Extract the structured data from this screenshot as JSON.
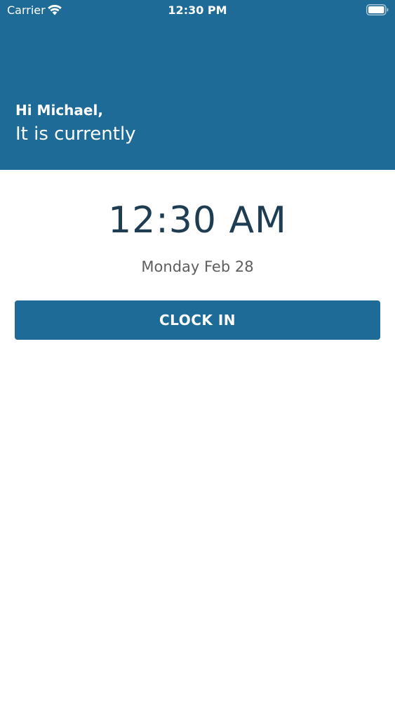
{
  "status_bar": {
    "carrier": "Carrier",
    "time": "12:30 PM"
  },
  "header": {
    "greeting": "Hi Michael,",
    "subtitle": "It is currently"
  },
  "clock": {
    "time": "12:30 AM",
    "date": "Monday Feb 28",
    "button_label": "CLOCK IN"
  },
  "colors": {
    "primary": "#1d6b96",
    "time_text": "#1e3d52",
    "date_text": "#5e5e5e"
  },
  "icons": {
    "wifi": "wifi-icon",
    "battery": "battery-icon"
  }
}
